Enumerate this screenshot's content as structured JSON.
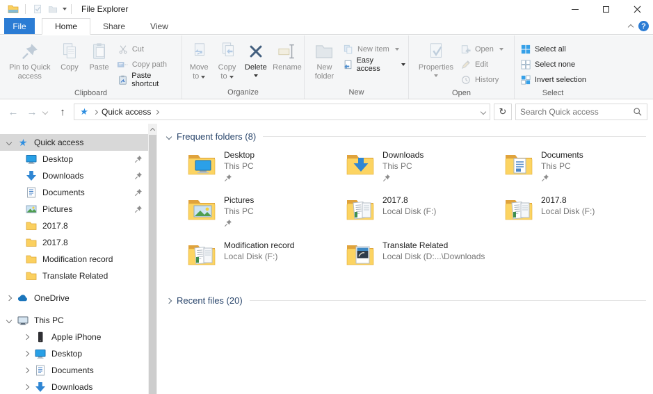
{
  "titlebar": {
    "title": "File Explorer"
  },
  "tabs": {
    "file": "File",
    "items": [
      "Home",
      "Share",
      "View"
    ]
  },
  "misc": {
    "help": "?",
    "back": "←",
    "forward": "→",
    "up": "↑",
    "refresh": "↻"
  },
  "ribbon": {
    "groups": [
      {
        "name": "Clipboard"
      },
      {
        "name": "Organize"
      },
      {
        "name": "New"
      },
      {
        "name": "Open"
      },
      {
        "name": "Select"
      }
    ],
    "buttons": {
      "pin_to_quick_access": "Pin to Quick access",
      "copy": "Copy",
      "paste": "Paste",
      "cut": "Cut",
      "copy_path": "Copy path",
      "paste_shortcut": "Paste shortcut",
      "move_to": "Move to",
      "copy_to": "Copy to",
      "delete": "Delete",
      "rename": "Rename",
      "new_folder": "New folder",
      "new_item": "New item",
      "easy_access": "Easy access",
      "properties": "Properties",
      "open": "Open",
      "edit": "Edit",
      "history": "History",
      "select_all": "Select all",
      "select_none": "Select none",
      "invert_selection": "Invert selection"
    }
  },
  "navbar": {
    "breadcrumb_root": "Quick access",
    "search_placeholder": "Search Quick access"
  },
  "sidebar": {
    "items": [
      {
        "label": "Quick access"
      },
      {
        "label": "Desktop"
      },
      {
        "label": "Downloads"
      },
      {
        "label": "Documents"
      },
      {
        "label": "Pictures"
      },
      {
        "label": "2017.8"
      },
      {
        "label": "2017.8"
      },
      {
        "label": "Modification record"
      },
      {
        "label": "Translate Related"
      },
      {
        "label": "OneDrive"
      },
      {
        "label": "This PC"
      },
      {
        "label": "Apple iPhone"
      },
      {
        "label": "Desktop"
      },
      {
        "label": "Documents"
      },
      {
        "label": "Downloads"
      }
    ]
  },
  "main": {
    "sections": [
      {
        "title": "Frequent folders (8)"
      },
      {
        "title": "Recent files (20)"
      }
    ],
    "tiles": [
      {
        "name": "Desktop",
        "location": "This PC"
      },
      {
        "name": "Downloads",
        "location": "This PC"
      },
      {
        "name": "Documents",
        "location": "This PC"
      },
      {
        "name": "Pictures",
        "location": "This PC"
      },
      {
        "name": "2017.8",
        "location": "Local Disk (F:)"
      },
      {
        "name": "2017.8",
        "location": "Local Disk (F:)"
      },
      {
        "name": "Modification record",
        "location": "Local Disk (F:)"
      },
      {
        "name": "Translate Related",
        "location": "Local Disk (D:...\\Downloads"
      }
    ]
  },
  "colors": {
    "accent_blue": "#2b7cd4",
    "folder_back": "#e0a33c",
    "folder_front": "#fcd462",
    "selection_gray": "#d8d8d8",
    "section_header": "#29456b"
  }
}
